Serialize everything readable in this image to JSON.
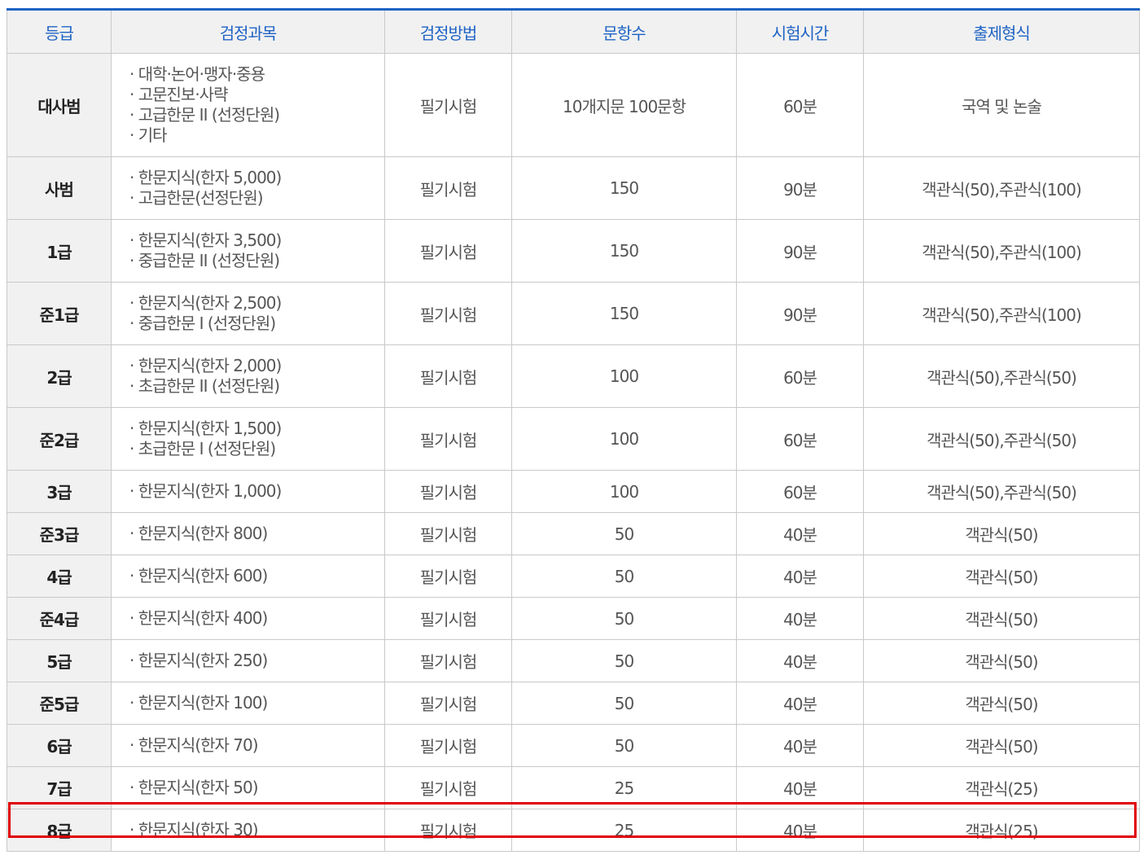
{
  "headers": [
    "등급",
    "검정과목",
    "검정방법",
    "문항수",
    "시험시간",
    "출제형식"
  ],
  "rows": [
    {
      "grade": "대사범",
      "subjects": [
        "대학·논어·맹자·중용",
        "고문진보·사략",
        "고급한문 II (선정단원)",
        "기타"
      ],
      "method": "필기시험",
      "count": "10개지문 100문항",
      "time": "60분",
      "format": "국역 및 논술"
    },
    {
      "grade": "사범",
      "subjects": [
        "한문지식(한자 5,000)",
        "고급한문(선정단원)"
      ],
      "method": "필기시험",
      "count": "150",
      "time": "90분",
      "format": "객관식(50),주관식(100)"
    },
    {
      "grade": "1급",
      "subjects": [
        "한문지식(한자 3,500)",
        "중급한문 II (선정단원)"
      ],
      "method": "필기시험",
      "count": "150",
      "time": "90분",
      "format": "객관식(50),주관식(100)"
    },
    {
      "grade": "준1급",
      "subjects": [
        "한문지식(한자 2,500)",
        "중급한문 I (선정단원)"
      ],
      "method": "필기시험",
      "count": "150",
      "time": "90분",
      "format": "객관식(50),주관식(100)"
    },
    {
      "grade": "2급",
      "subjects": [
        "한문지식(한자 2,000)",
        "초급한문 II (선정단원)"
      ],
      "method": "필기시험",
      "count": "100",
      "time": "60분",
      "format": "객관식(50),주관식(50)"
    },
    {
      "grade": "준2급",
      "subjects": [
        "한문지식(한자 1,500)",
        "초급한문 I (선정단원)"
      ],
      "method": "필기시험",
      "count": "100",
      "time": "60분",
      "format": "객관식(50),주관식(50)"
    },
    {
      "grade": "3급",
      "subjects": [
        "한문지식(한자 1,000)"
      ],
      "method": "필기시험",
      "count": "100",
      "time": "60분",
      "format": "객관식(50),주관식(50)"
    },
    {
      "grade": "준3급",
      "subjects": [
        "한문지식(한자 800)"
      ],
      "method": "필기시험",
      "count": "50",
      "time": "40분",
      "format": "객관식(50)"
    },
    {
      "grade": "4급",
      "subjects": [
        "한문지식(한자 600)"
      ],
      "method": "필기시험",
      "count": "50",
      "time": "40분",
      "format": "객관식(50)"
    },
    {
      "grade": "준4급",
      "subjects": [
        "한문지식(한자 400)"
      ],
      "method": "필기시험",
      "count": "50",
      "time": "40분",
      "format": "객관식(50)"
    },
    {
      "grade": "5급",
      "subjects": [
        "한문지식(한자 250)"
      ],
      "method": "필기시험",
      "count": "50",
      "time": "40분",
      "format": "객관식(50)"
    },
    {
      "grade": "준5급",
      "subjects": [
        "한문지식(한자 100)"
      ],
      "method": "필기시험",
      "count": "50",
      "time": "40분",
      "format": "객관식(50)"
    },
    {
      "grade": "6급",
      "subjects": [
        "한문지식(한자 70)"
      ],
      "method": "필기시험",
      "count": "50",
      "time": "40분",
      "format": "객관식(50)"
    },
    {
      "grade": "7급",
      "subjects": [
        "한문지식(한자 50)"
      ],
      "method": "필기시험",
      "count": "25",
      "time": "40분",
      "format": "객관식(25)"
    },
    {
      "grade": "8급",
      "subjects": [
        "한문지식(한자 30)"
      ],
      "method": "필기시험",
      "count": "25",
      "time": "40분",
      "format": "객관식(25)"
    }
  ],
  "highlighted_row": "8급",
  "colors": {
    "header_text": "#1e63c4",
    "top_border": "#1e63c4",
    "highlight_border": "#e00000",
    "header_bg": "#f1f1f1"
  }
}
